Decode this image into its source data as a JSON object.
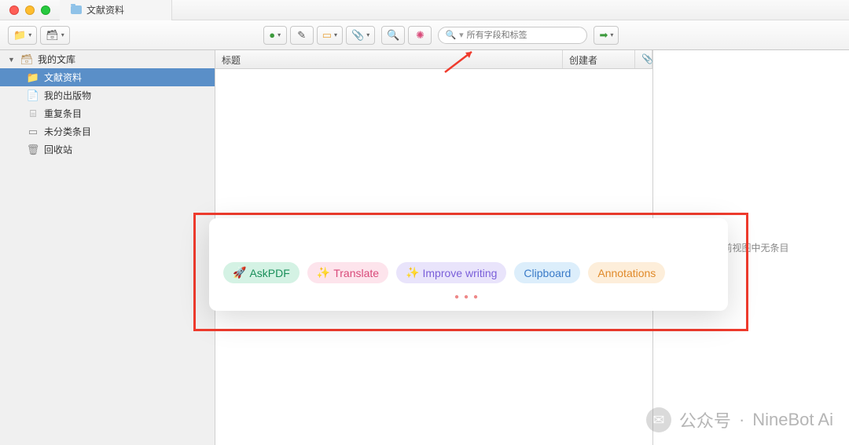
{
  "tab": {
    "title": "文献资料"
  },
  "toolbar": {
    "search_placeholder": "所有字段和标签"
  },
  "sidebar": {
    "root": "我的文库",
    "items": [
      {
        "label": "文献资料",
        "icon": "folder",
        "selected": true
      },
      {
        "label": "我的出版物",
        "icon": "page"
      },
      {
        "label": "重复条目",
        "icon": "grey"
      },
      {
        "label": "未分类条目",
        "icon": "grey"
      },
      {
        "label": "回收站",
        "icon": "grey"
      }
    ]
  },
  "columns": {
    "title": "标题",
    "creator": "创建者"
  },
  "rightpane": {
    "empty": "当前视图中无条目"
  },
  "popup": {
    "pills": {
      "askpdf": "AskPDF",
      "translate": "Translate",
      "improve": "Improve writing",
      "clipboard": "Clipboard",
      "annotations": "Annotations"
    }
  },
  "watermark": {
    "prefix": "公众号",
    "sep": "·",
    "name": "NineBot Ai"
  }
}
